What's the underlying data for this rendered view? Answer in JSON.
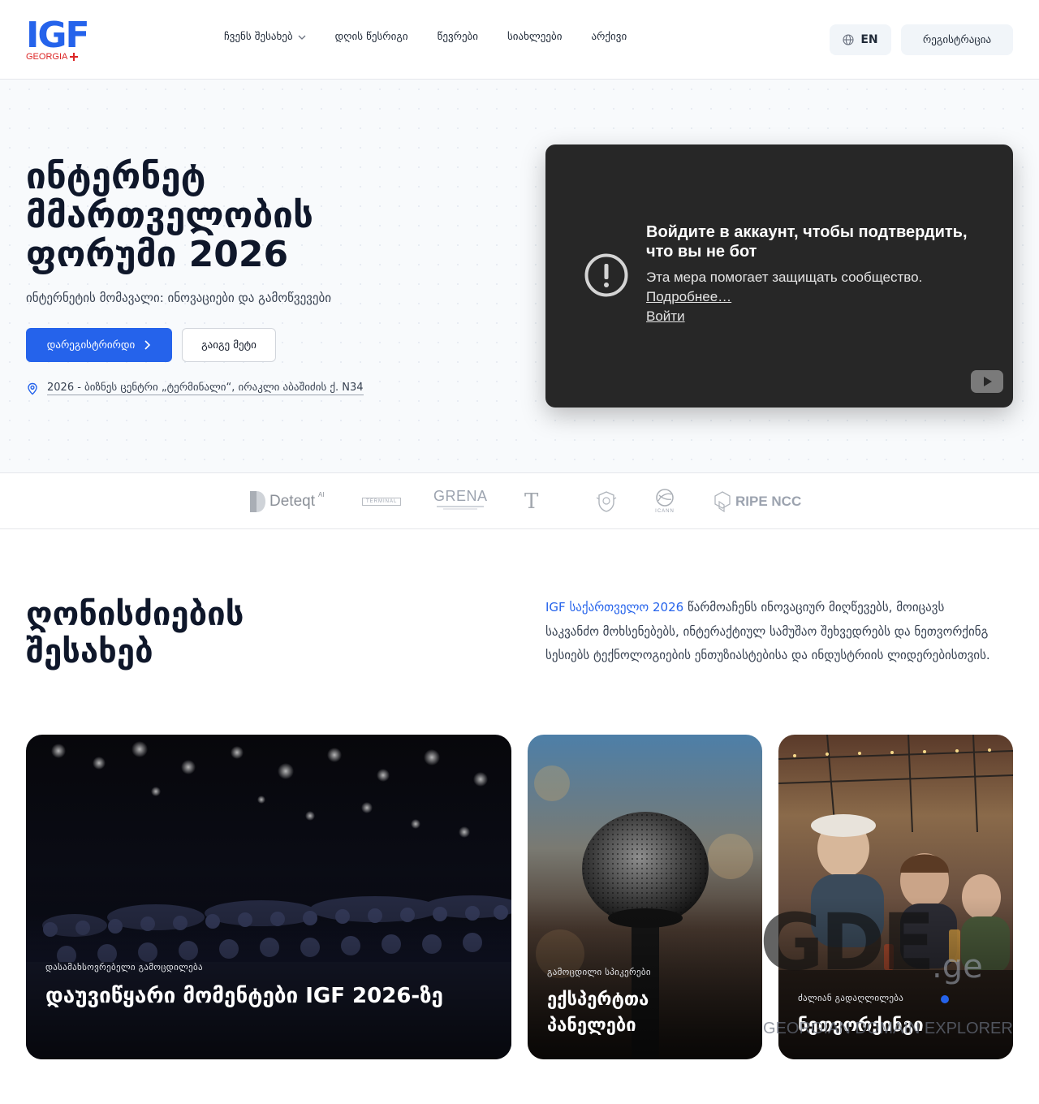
{
  "header": {
    "logo_text": "IGF",
    "logo_sub": "GEORGIA",
    "nav": [
      {
        "label": "ჩვენს შესახებ",
        "has_dropdown": true
      },
      {
        "label": "დღის წესრიგი",
        "has_dropdown": false
      },
      {
        "label": "წევრები",
        "has_dropdown": false
      },
      {
        "label": "სიახლეები",
        "has_dropdown": false
      },
      {
        "label": "არქივი",
        "has_dropdown": false
      }
    ],
    "lang_label": "EN",
    "register_label": "რეგისტრაცია"
  },
  "hero": {
    "title_lines": [
      "ინტერნეტ",
      "მმართველობის",
      "ფორუმი 2026"
    ],
    "subtitle": "ინტერნეტის მომავალი: ინოვაციები და გამოწვევები",
    "primary_button": "დარეგისტრირდი",
    "secondary_button": "გაიგე მეტი",
    "location": "2026 - ბიზნეს ცენტრი „ტერმინალი“, ირაკლი აბაშიძის ქ. N34"
  },
  "video": {
    "title": "Войдите в аккаунт, чтобы подтвердить, что вы не бот",
    "body": "Эта мера помогает защищать сообщество.",
    "link_more": "Подробнее…",
    "link_signin": "Войти"
  },
  "partners": {
    "items": [
      {
        "name": "Deteqt",
        "sup": "AI"
      },
      {
        "name": "TERMINAL"
      },
      {
        "name": "GRENA"
      },
      {
        "name": "T"
      },
      {
        "name": "coat-of-arms"
      },
      {
        "name": "ICANN"
      },
      {
        "name": "RIPE NCC"
      }
    ]
  },
  "about": {
    "title_lines": [
      "ღონისძიების",
      "შესახებ"
    ],
    "text_accent": "IGF საქართველო 2026",
    "text_rest": " წარმოაჩენს ინოვაციურ მიღწევებს, მოიცავს საკვანძო მოხსენებებს, ინტერაქტიულ სამუშაო შეხვედრებს და ნეთვორქინგ სესიებს ტექნოლოგიების ენთუზიასტებისა და ინდუსტრიის ლიდერებისთვის."
  },
  "cards": [
    {
      "label": "დასამახსოვრებელი გამოცდილება",
      "title": "დაუვიწყარი მომენტები IGF 2026-ზე"
    },
    {
      "label": "გამოცდილი სპიკერები",
      "title": "ექსპერტთა პანელები"
    },
    {
      "label": "ძალიან გადაღლილება",
      "title": "ნეთვორქინგი"
    }
  ],
  "watermark": {
    "text": "GDE",
    "suffix": ".ge",
    "caption": "GEORGIAN DOMAIN EXPLORER"
  }
}
